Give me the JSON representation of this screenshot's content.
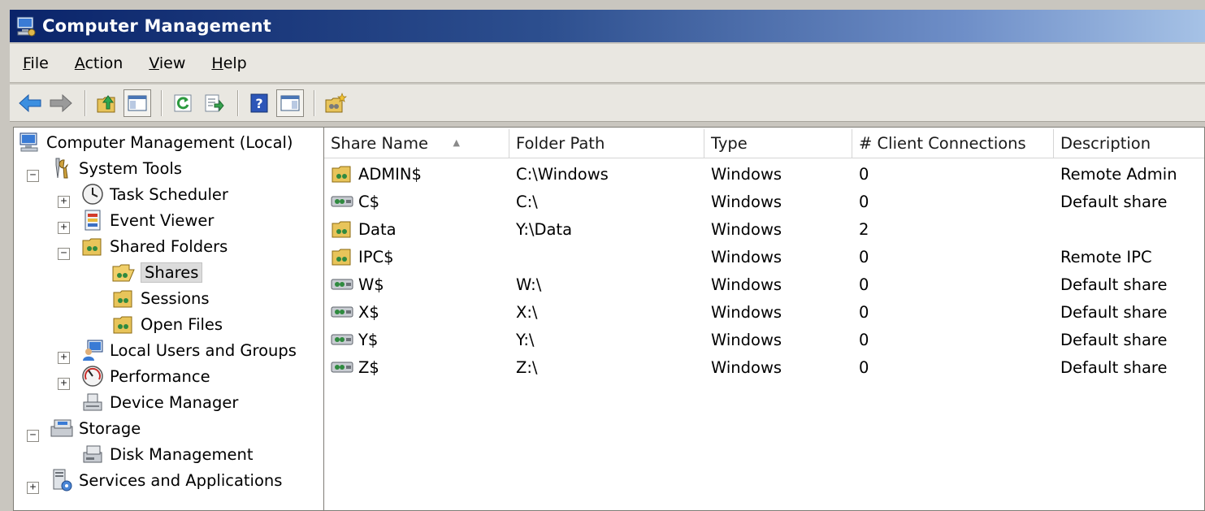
{
  "window": {
    "title": "Computer Management"
  },
  "menu": [
    {
      "label": "File",
      "u": "F",
      "rest": "ile"
    },
    {
      "label": "Action",
      "u": "A",
      "rest": "ction"
    },
    {
      "label": "View",
      "u": "V",
      "rest": "iew"
    },
    {
      "label": "Help",
      "u": "H",
      "rest": "elp"
    }
  ],
  "toolbar": {
    "buttons": [
      "back-arrow-icon",
      "forward-arrow-icon",
      "up-folder-icon",
      "show-hide-tree-icon",
      "refresh-icon",
      "export-list-icon",
      "help-icon",
      "show-hide-action-pane-icon",
      "new-share-icon"
    ]
  },
  "tree": {
    "root": "Computer Management (Local)",
    "system_tools": "System Tools",
    "task_scheduler": "Task Scheduler",
    "event_viewer": "Event Viewer",
    "shared_folders": "Shared Folders",
    "shares": "Shares",
    "sessions": "Sessions",
    "open_files": "Open Files",
    "local_users": "Local Users and Groups",
    "performance": "Performance",
    "device_manager": "Device Manager",
    "storage": "Storage",
    "disk_management": "Disk Management",
    "services": "Services and Applications",
    "expand_symbol": "+",
    "collapse_symbol": "−"
  },
  "table": {
    "columns": [
      "Share Name",
      "Folder Path",
      "Type",
      "# Client Connections",
      "Description"
    ],
    "sort_indicator": "▲",
    "rows": [
      {
        "name": "ADMIN$",
        "path": "C:\\Windows",
        "type": "Windows",
        "conn": "0",
        "desc": "Remote Admin",
        "icon": "share-folder-icon"
      },
      {
        "name": "C$",
        "path": "C:\\",
        "type": "Windows",
        "conn": "0",
        "desc": "Default share",
        "icon": "share-drive-icon"
      },
      {
        "name": "Data",
        "path": "Y:\\Data",
        "type": "Windows",
        "conn": "2",
        "desc": "",
        "icon": "share-folder-icon"
      },
      {
        "name": "IPC$",
        "path": "",
        "type": "Windows",
        "conn": "0",
        "desc": "Remote IPC",
        "icon": "share-folder-icon"
      },
      {
        "name": "W$",
        "path": "W:\\",
        "type": "Windows",
        "conn": "0",
        "desc": "Default share",
        "icon": "share-drive-icon"
      },
      {
        "name": "X$",
        "path": "X:\\",
        "type": "Windows",
        "conn": "0",
        "desc": "Default share",
        "icon": "share-drive-icon"
      },
      {
        "name": "Y$",
        "path": "Y:\\",
        "type": "Windows",
        "conn": "0",
        "desc": "Default share",
        "icon": "share-drive-icon"
      },
      {
        "name": "Z$",
        "path": "Z:\\",
        "type": "Windows",
        "conn": "0",
        "desc": "Default share",
        "icon": "share-drive-icon"
      }
    ]
  }
}
